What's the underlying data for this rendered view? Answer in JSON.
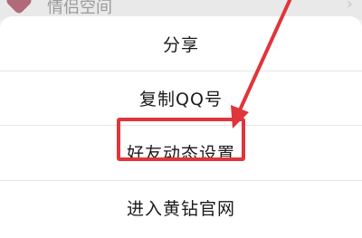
{
  "background_row": {
    "label": "情侣空间",
    "icon": "diamond-app-icon",
    "chevron": "›"
  },
  "menu": {
    "items": [
      {
        "label": "分享"
      },
      {
        "label": "复制QQ号"
      },
      {
        "label": "好友动态设置"
      },
      {
        "label": "进入黄钻官网"
      }
    ]
  },
  "annotation": {
    "highlighted_item_index": 2,
    "color": "#e0353b"
  }
}
